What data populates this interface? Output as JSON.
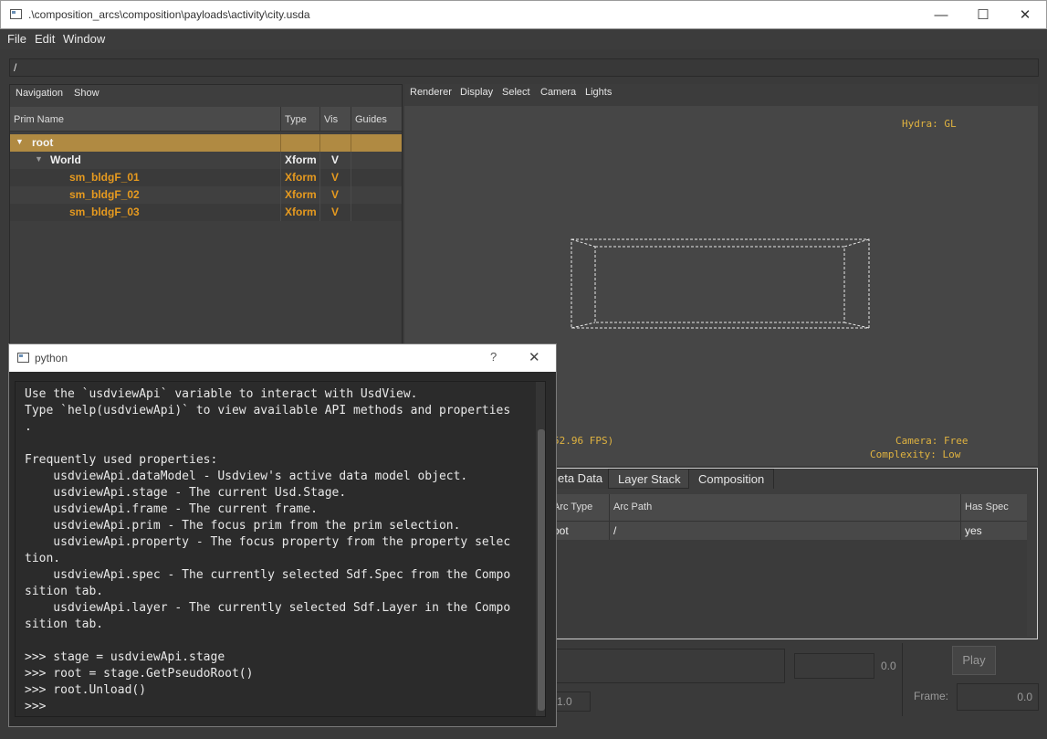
{
  "window": {
    "title": ".\\composition_arcs\\composition\\payloads\\activity\\city.usda",
    "minimize": "—",
    "maximize": "☐",
    "close": "✕"
  },
  "menu": {
    "file": "File",
    "edit": "Edit",
    "window": "Window"
  },
  "path": "/",
  "navigation": {
    "menu_navigation": "Navigation",
    "menu_show": "Show",
    "columns": [
      "Prim Name",
      "Type",
      "Vis",
      "Guides"
    ],
    "rows": [
      {
        "name": "root",
        "type": "",
        "vis": ""
      },
      {
        "name": "World",
        "type": "Xform",
        "vis": "V"
      },
      {
        "name": "sm_bldgF_01",
        "type": "Xform",
        "vis": "V"
      },
      {
        "name": "sm_bldgF_02",
        "type": "Xform",
        "vis": "V"
      },
      {
        "name": "sm_bldgF_03",
        "type": "Xform",
        "vis": "V"
      }
    ]
  },
  "viewport": {
    "menu": [
      "Renderer",
      "Display",
      "Select",
      "Camera",
      "Lights"
    ],
    "hud_renderer": "Hydra: GL",
    "hud_fps": "52.96 FPS)",
    "hud_camera": "Camera: Free",
    "hud_complexity": "Complexity: Low"
  },
  "inspector": {
    "tabs": [
      "eta Data",
      "Layer Stack",
      "Composition"
    ],
    "columns": [
      "Arc Type",
      "Arc Path",
      "Has Spec"
    ],
    "row": {
      "arc_type": "oot",
      "arc_path": "/",
      "has_spec": "yes"
    }
  },
  "playback": {
    "min_value": "0.0",
    "play": "Play",
    "frame_label": "Frame:",
    "frame_value": "0.0",
    "step_value": "1.0"
  },
  "python": {
    "title": "python",
    "help": "?",
    "close": "✕",
    "console_text": "Use the `usdviewApi` variable to interact with UsdView.\nType `help(usdviewApi)` to view available API methods and properties\n.\n\nFrequently used properties:\n    usdviewApi.dataModel - Usdview's active data model object.\n    usdviewApi.stage - The current Usd.Stage.\n    usdviewApi.frame - The current frame.\n    usdviewApi.prim - The focus prim from the prim selection.\n    usdviewApi.property - The focus property from the property selec\ntion.\n    usdviewApi.spec - The currently selected Sdf.Spec from the Compo\nsition tab.\n    usdviewApi.layer - The currently selected Sdf.Layer in the Compo\nsition tab.\n\n>>> stage = usdviewApi.stage\n>>> root = stage.GetPseudoRoot()\n>>> root.Unload()\n>>>"
  },
  "colors": {
    "accent_orange": "#e69a1f",
    "selected_row": "#b08a42",
    "hud_yellow": "#e0b340"
  }
}
